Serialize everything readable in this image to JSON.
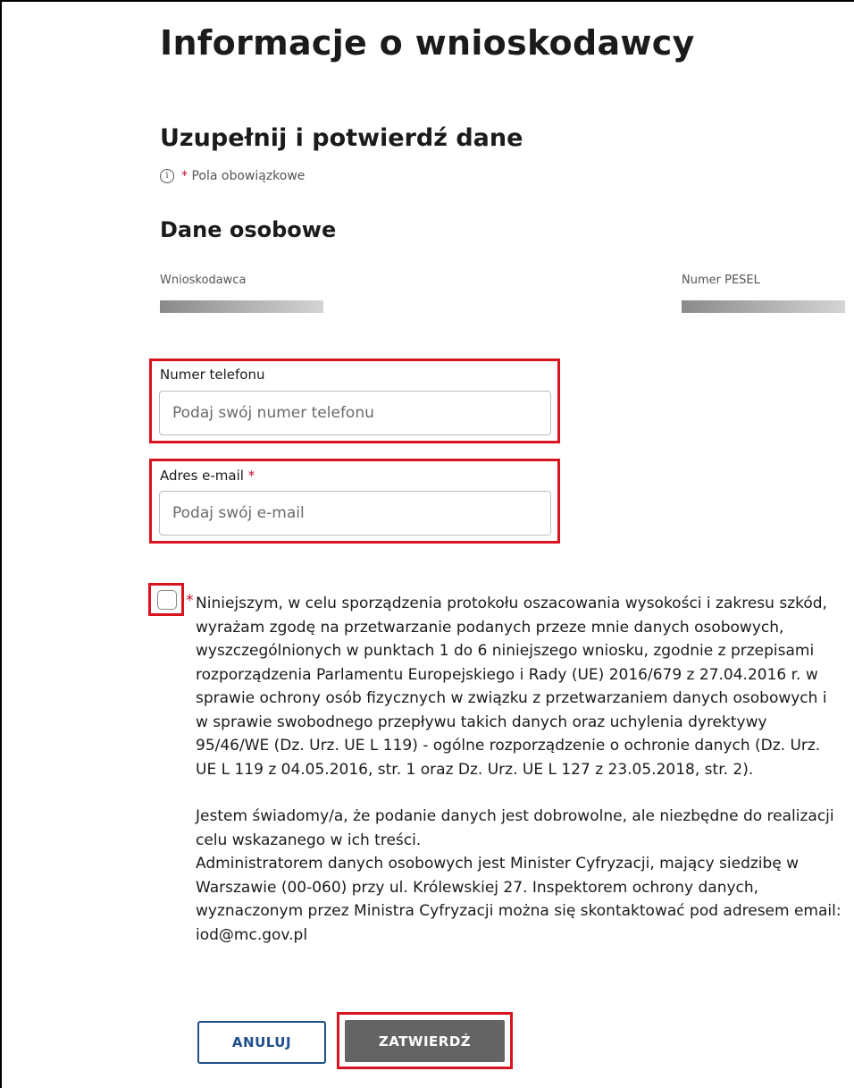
{
  "page": {
    "title": "Informacje o wnioskodawcy",
    "subtitle": "Uzupełnij i potwierdź dane",
    "required_note": "Pola obowiązkowe",
    "required_star": "*",
    "info_icon": "info-circle-icon",
    "section_title": "Dane osobowe"
  },
  "personal": {
    "applicant_label": "Wnioskodawca",
    "pesel_label": "Numer PESEL"
  },
  "form": {
    "phone": {
      "label": "Numer telefonu",
      "placeholder": "Podaj swój numer telefonu",
      "value": ""
    },
    "email": {
      "label": "Adres e-mail",
      "required_star": "*",
      "placeholder": "Podaj swój e-mail",
      "value": ""
    }
  },
  "consent": {
    "checked": false,
    "required_star": "*",
    "paragraph1": "Niniejszym, w celu sporządzenia protokołu oszacowania wysokości i zakresu szkód, wyrażam zgodę na przetwarzanie podanych przeze mnie danych osobowych, wyszczególnionych w punktach 1 do 6 niniejszego wniosku, zgodnie z przepisami rozporządzenia Parlamentu Europejskiego i Rady (UE) 2016/679 z 27.04.2016 r. w sprawie ochrony osób fizycznych w związku z przetwarzaniem danych osobowych i w sprawie swobodnego przepływu takich danych oraz uchylenia dyrektywy 95/46/WE (Dz. Urz. UE L 119) - ogólne rozporządzenie o ochronie danych (Dz. Urz. UE L 119 z 04.05.2016, str. 1 oraz Dz. Urz. UE L 127 z 23.05.2018, str. 2).",
    "paragraph2": "Jestem świadomy/a, że podanie danych jest dobrowolne, ale niezbędne do realizacji celu wskazanego w ich treści.",
    "paragraph3": "Administratorem danych osobowych jest Minister Cyfryzacji, mający siedzibę w Warszawie (00-060) przy ul. Królewskiej 27. Inspektorem ochrony danych, wyznaczonym przez Ministra Cyfryzacji można się skontaktować pod adresem email: iod@mc.gov.pl"
  },
  "buttons": {
    "cancel": "ANULUJ",
    "submit": "ZATWIERDŹ"
  },
  "colors": {
    "highlight_border": "#d7141f",
    "required_star": "#c8102e",
    "cancel_button": "#1f4f8b",
    "submit_button": "#646464"
  }
}
